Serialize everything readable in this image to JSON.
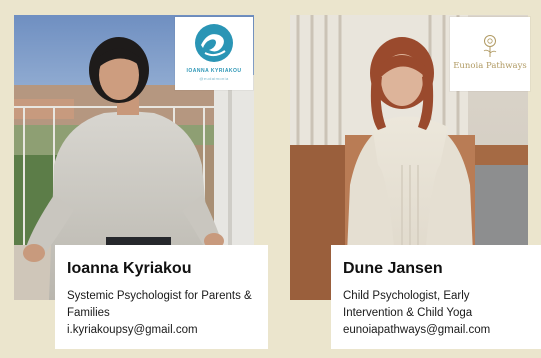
{
  "cards": [
    {
      "logo": {
        "icon": "wave-logo-icon",
        "title": "IOANNA KYRIAKOU",
        "subtitle": "@eudaimonia",
        "color": "#2a95b5"
      },
      "name": "Ioanna Kyriakou",
      "role": "Systemic Psychologist for Parents & Families",
      "email": "i.kyriakoupsy@gmail.com"
    },
    {
      "logo": {
        "icon": "flower-logo-icon",
        "title": "Eunoia Pathways",
        "color": "#b09a63"
      },
      "name": "Dune Jansen",
      "role": "Child Psychologist, Early Intervention & Child Yoga",
      "email": "eunoiapathways@gmail.com"
    }
  ],
  "colors": {
    "background": "#ebe5cd",
    "caption_bg": "#ffffff",
    "text": "#111111"
  }
}
